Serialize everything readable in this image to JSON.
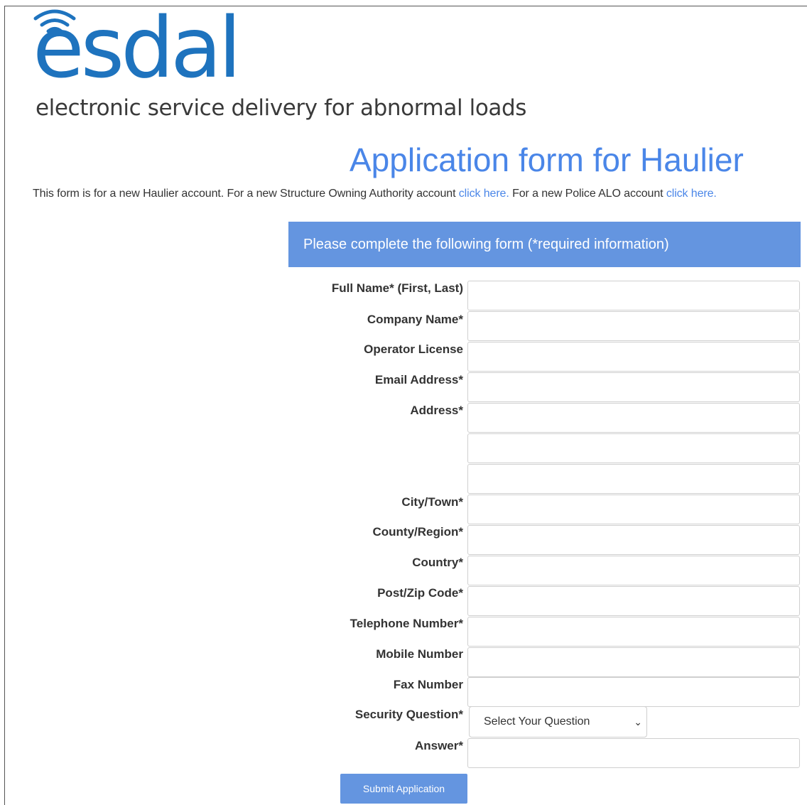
{
  "branding": {
    "logo_text": "esdal",
    "tagline": "electronic service delivery for abnormal loads",
    "colors": {
      "logo_blue": "#1e73be",
      "accent": "#4a86e8",
      "header_bg": "#6495e0"
    }
  },
  "page": {
    "title": "Application form for Haulier",
    "intro_text_1": "This form is for a new Haulier account. For a new Structure Owning Authority account ",
    "intro_link_1": "click here.",
    "intro_text_2": " For a new Police ALO account ",
    "intro_link_2": "click here."
  },
  "form": {
    "header": "Please complete the following form (*required information)",
    "labels": {
      "full_name": "Full Name* (First, Last)",
      "company_name": "Company Name*",
      "operator_license": "Operator License",
      "email": "Email Address*",
      "address": "Address*",
      "city": "City/Town*",
      "county": "County/Region*",
      "country": "Country*",
      "postcode": "Post/Zip Code*",
      "telephone": "Telephone Number*",
      "mobile": "Mobile Number",
      "fax": "Fax Number",
      "security_question": "Security Question*",
      "answer": "Answer*"
    },
    "values": {
      "full_name": "",
      "company_name": "",
      "operator_license": "",
      "email": "",
      "address_1": "",
      "address_2": "",
      "address_3": "",
      "city": "",
      "county": "",
      "country": "",
      "postcode": "",
      "telephone": "",
      "mobile": "",
      "fax": "",
      "answer": ""
    },
    "security_question_selected": "Select Your Question",
    "submit_label": "Submit Application"
  }
}
